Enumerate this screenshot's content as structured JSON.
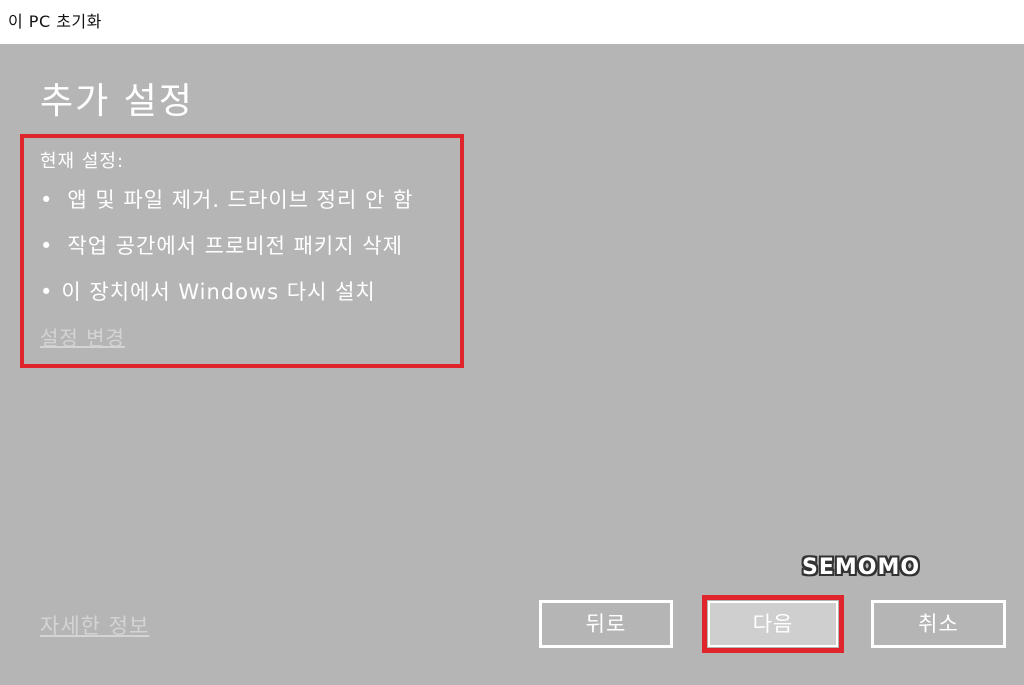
{
  "window": {
    "title": "이 PC 초기화"
  },
  "main": {
    "heading": "추가 설정",
    "current_settings_label": "현재 설정:",
    "settings_items": [
      "앱 및 파일 제거. 드라이브 정리 안 함",
      "작업 공간에서 프로비전 패키지 삭제",
      "이 장치에서 Windows 다시 설치"
    ],
    "bullet_char": "•",
    "change_settings_link": "설정 변경",
    "more_info_link": "자세한 정보"
  },
  "buttons": {
    "back": "뒤로",
    "next": "다음",
    "cancel": "취소"
  },
  "watermark": "SEMOMO",
  "colors": {
    "background": "#b5b5b5",
    "titlebar": "#ffffff",
    "highlight_red": "#e0242c",
    "text": "#ffffff",
    "link": "#d4d4d4",
    "next_button_fill": "#cfcfcf"
  }
}
